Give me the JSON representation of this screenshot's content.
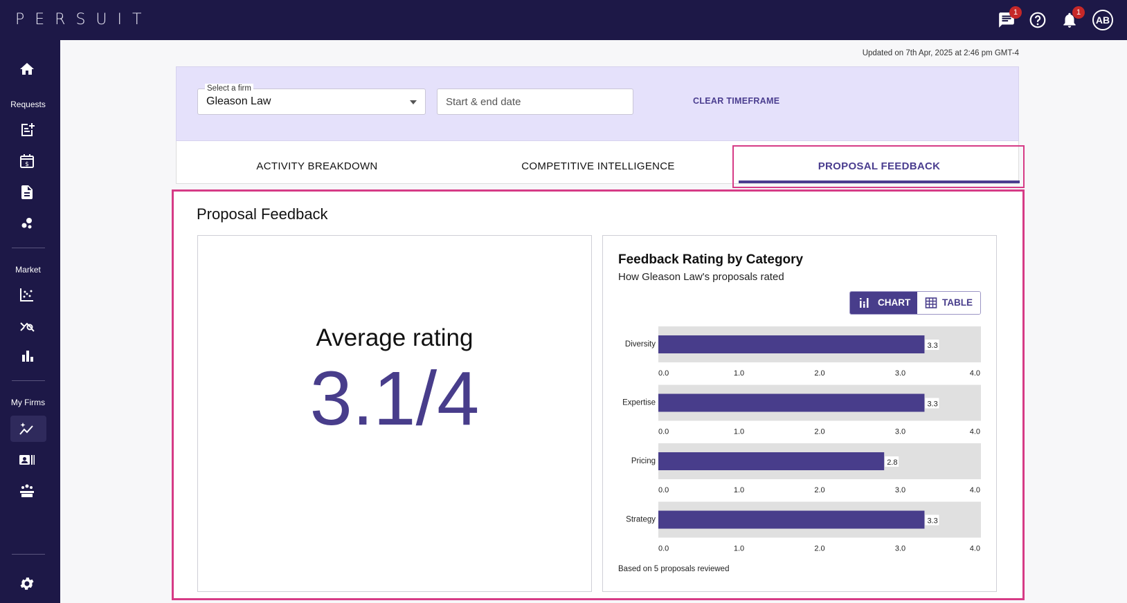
{
  "topbar": {
    "logo": "PERSUIT",
    "messages_badge": "1",
    "notifications_badge": "1",
    "avatar_initials": "AB"
  },
  "sidebar": {
    "sections": [
      "Requests",
      "Market",
      "My Firms"
    ],
    "icons": [
      "home-icon",
      "new-request-icon",
      "calendar-dollar-icon",
      "document-icon",
      "network-icon",
      "scatter-chart-icon",
      "analytics-search-icon",
      "bar-chart-icon",
      "firm-trends-icon",
      "contact-card-icon",
      "team-icon",
      "settings-icon"
    ]
  },
  "updated": "Updated on 7th Apr, 2025 at 2:46 pm GMT-4",
  "filters": {
    "firm_label": "Select a firm",
    "firm_value": "Gleason  Law",
    "date_placeholder": "Start & end date",
    "clear_label": "CLEAR TIMEFRAME"
  },
  "tabs": [
    {
      "label": "ACTIVITY BREAKDOWN",
      "active": false
    },
    {
      "label": "COMPETITIVE INTELLIGENCE",
      "active": false
    },
    {
      "label": "PROPOSAL FEEDBACK",
      "active": true
    }
  ],
  "panel": {
    "title": "Proposal Feedback",
    "average_label": "Average rating",
    "average_value": "3.1/4"
  },
  "feedback": {
    "title": "Feedback Rating by Category",
    "subtitle": "How Gleason Law's proposals rated",
    "toggle_chart": "CHART",
    "toggle_table": "TABLE",
    "footnote": "Based on 5 proposals reviewed"
  },
  "colors": {
    "navy": "#1d1847",
    "accent": "#483d8b",
    "highlight": "#d63b86",
    "filter_bg": "#e5e1fb"
  },
  "chart_data": {
    "type": "bar",
    "orientation": "horizontal",
    "categories": [
      "Diversity",
      "Expertise",
      "Pricing",
      "Strategy"
    ],
    "values": [
      3.3,
      3.3,
      2.8,
      3.3
    ],
    "value_labels": [
      "3.3",
      "3.3",
      "2.8",
      "3.3"
    ],
    "xlim": [
      0,
      4
    ],
    "ticks": [
      "0.0",
      "1.0",
      "2.0",
      "3.0",
      "4.0"
    ],
    "title": "Feedback Rating by Category",
    "subtitle": "How Gleason Law's proposals rated"
  }
}
